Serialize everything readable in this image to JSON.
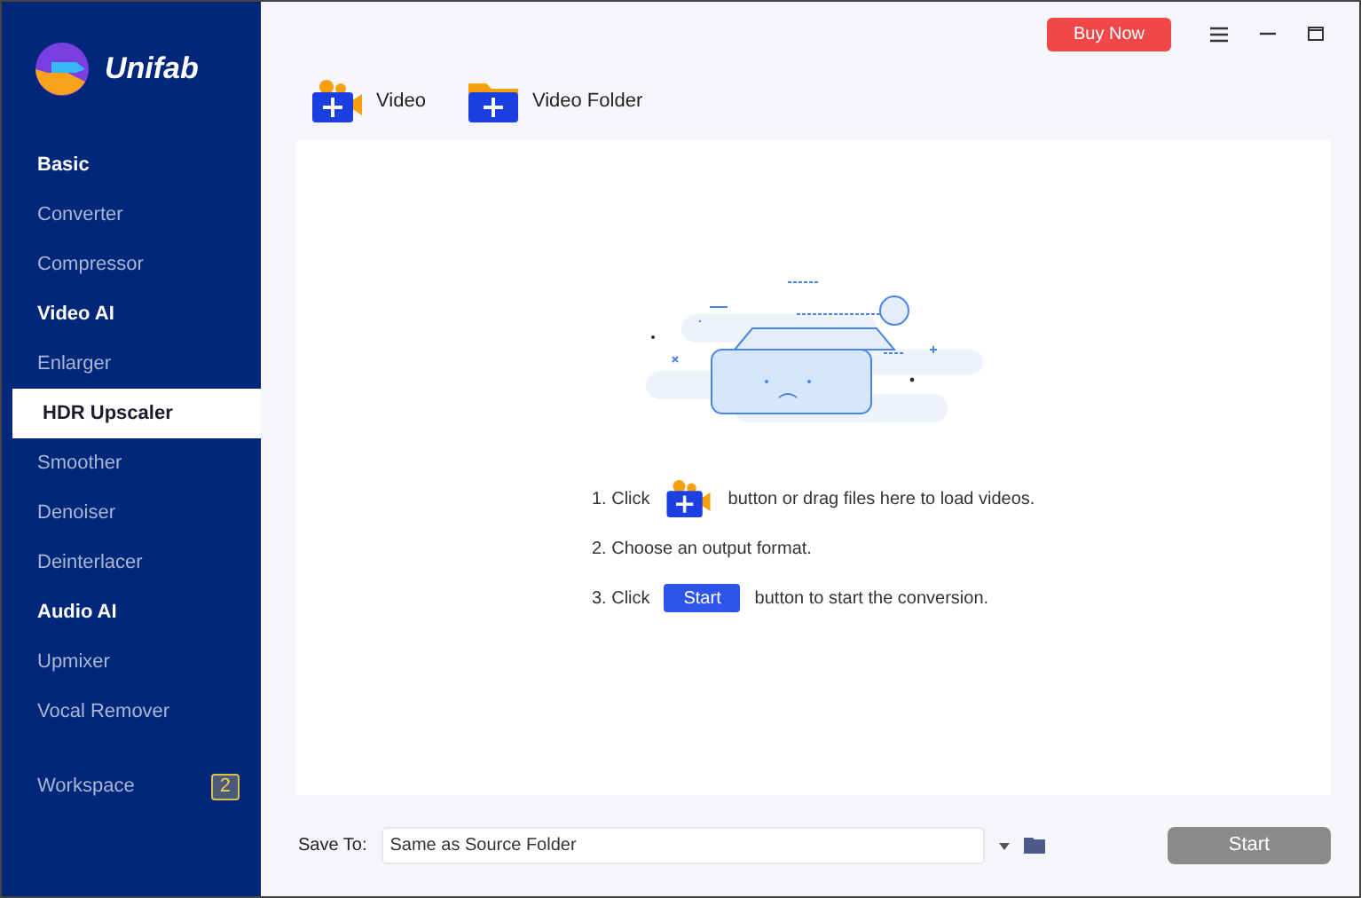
{
  "app": {
    "name": "Unifab"
  },
  "sidebar": {
    "items": [
      {
        "kind": "header",
        "label": "Basic",
        "selected": false
      },
      {
        "kind": "item",
        "label": "Converter",
        "selected": false
      },
      {
        "kind": "item",
        "label": "Compressor",
        "selected": false
      },
      {
        "kind": "header",
        "label": "Video AI",
        "selected": false
      },
      {
        "kind": "item",
        "label": "Enlarger",
        "selected": false
      },
      {
        "kind": "item",
        "label": "HDR Upscaler",
        "selected": true
      },
      {
        "kind": "item",
        "label": "Smoother",
        "selected": false
      },
      {
        "kind": "item",
        "label": "Denoiser",
        "selected": false
      },
      {
        "kind": "item",
        "label": "Deinterlacer",
        "selected": false
      },
      {
        "kind": "header",
        "label": "Audio AI",
        "selected": false
      },
      {
        "kind": "item",
        "label": "Upmixer",
        "selected": false
      },
      {
        "kind": "item",
        "label": "Vocal Remover",
        "selected": false
      }
    ],
    "workspace": {
      "label": "Workspace",
      "count": "2"
    }
  },
  "top_bar": {
    "buy_button": "Buy Now"
  },
  "toolbar": [
    {
      "kind": "video",
      "label": "Video"
    },
    {
      "kind": "folder",
      "label": "Video Folder"
    }
  ],
  "instructions": [
    {
      "kind": "video",
      "lead": "1. Click",
      "text": "button or drag files here to load videos."
    },
    {
      "kind": "plain",
      "lead": "2. Choose an output format."
    },
    {
      "kind": "start",
      "lead": "3. Click",
      "button": "Start",
      "text": "button to start the conversion."
    }
  ],
  "bottom_bar": {
    "label": "Save To:",
    "value": "Same as Source Folder",
    "start_button": "Start",
    "start_disabled": true
  }
}
